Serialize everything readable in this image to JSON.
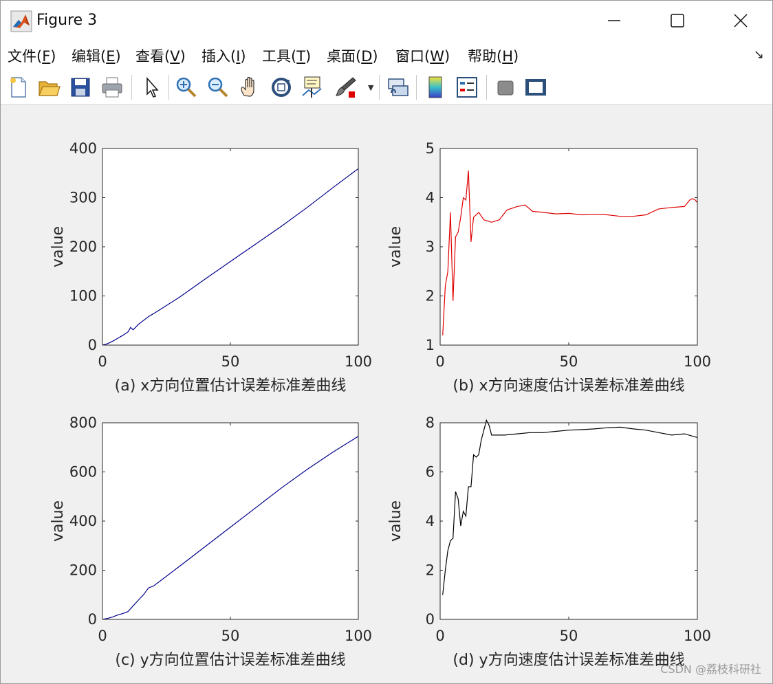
{
  "window": {
    "title": "Figure 3",
    "min_icon": "minimize-icon",
    "max_icon": "maximize-icon",
    "close_icon": "close-icon"
  },
  "menubar": {
    "items": [
      {
        "label": "文件(",
        "key": "F",
        "tail": ")"
      },
      {
        "label": "编辑(",
        "key": "E",
        "tail": ")"
      },
      {
        "label": "查看(",
        "key": "V",
        "tail": ")"
      },
      {
        "label": "插入(",
        "key": "I",
        "tail": ")"
      },
      {
        "label": "工具(",
        "key": "T",
        "tail": ")"
      },
      {
        "label": "桌面(",
        "key": "D",
        "tail": ")"
      },
      {
        "label": "窗口(",
        "key": "W",
        "tail": ")"
      },
      {
        "label": "帮助(",
        "key": "H",
        "tail": ")"
      }
    ],
    "corner_glyph": "↘"
  },
  "toolbar": {
    "icons": [
      "new-figure-icon",
      "open-file-icon",
      "save-icon",
      "print-icon",
      "edit-plot-arrow-icon",
      "zoom-in-icon",
      "zoom-out-icon",
      "pan-hand-icon",
      "rotate-3d-icon",
      "data-cursor-icon",
      "brush-icon",
      "brush-dropdown-icon",
      "link-plot-icon",
      "colorbar-icon",
      "legend-icon",
      "hide-plot-tools-icon",
      "show-plot-tools-icon"
    ]
  },
  "colors": {
    "blue_series": "#00008b",
    "red_series": "#e00000",
    "black_series": "#000000"
  },
  "chart_data": [
    {
      "type": "line",
      "caption": "(a) x方向位置估计误差标准差曲线",
      "ylabel": "value",
      "xlim": [
        0,
        100
      ],
      "ylim": [
        0,
        400
      ],
      "xticks": [
        0,
        50,
        100
      ],
      "yticks": [
        0,
        100,
        200,
        300,
        400
      ],
      "color": "#00008b",
      "x": [
        0,
        2,
        4,
        6,
        8,
        10,
        11,
        12,
        14,
        16,
        18,
        20,
        30,
        40,
        50,
        60,
        70,
        80,
        90,
        100
      ],
      "y": [
        0,
        3,
        8,
        14,
        20,
        27,
        36,
        31,
        42,
        50,
        58,
        64,
        97,
        134,
        170,
        206,
        242,
        280,
        320,
        359
      ]
    },
    {
      "type": "line",
      "caption": "(b) x方向速度估计误差标准差曲线",
      "ylabel": "value",
      "xlim": [
        0,
        100
      ],
      "ylim": [
        1,
        5
      ],
      "xticks": [
        0,
        50,
        100
      ],
      "yticks": [
        1,
        2,
        3,
        4,
        5
      ],
      "color": "#e00000",
      "x": [
        1,
        2,
        3,
        4,
        5,
        6,
        7,
        8,
        9,
        10,
        11,
        12,
        13,
        15,
        17,
        20,
        23,
        26,
        30,
        33,
        36,
        40,
        45,
        50,
        55,
        60,
        65,
        70,
        75,
        80,
        85,
        90,
        95,
        97,
        98,
        99,
        100
      ],
      "y": [
        1.2,
        2.2,
        2.5,
        3.7,
        1.9,
        3.2,
        3.3,
        3.6,
        4.0,
        3.95,
        4.55,
        3.1,
        3.6,
        3.7,
        3.55,
        3.5,
        3.55,
        3.75,
        3.82,
        3.85,
        3.72,
        3.7,
        3.67,
        3.68,
        3.65,
        3.66,
        3.65,
        3.62,
        3.62,
        3.65,
        3.77,
        3.8,
        3.82,
        3.95,
        3.98,
        3.96,
        3.9
      ]
    },
    {
      "type": "line",
      "caption": "(c) y方向位置估计误差标准差曲线",
      "ylabel": "value",
      "xlim": [
        0,
        100
      ],
      "ylim": [
        0,
        800
      ],
      "xticks": [
        0,
        50,
        100
      ],
      "yticks": [
        0,
        200,
        400,
        600,
        800
      ],
      "color": "#00008b",
      "x": [
        0,
        2,
        4,
        6,
        8,
        10,
        12,
        14,
        16,
        18,
        20,
        30,
        40,
        50,
        60,
        70,
        80,
        90,
        100
      ],
      "y": [
        0,
        4,
        10,
        18,
        24,
        32,
        55,
        78,
        100,
        128,
        136,
        215,
        295,
        375,
        455,
        535,
        610,
        680,
        745
      ]
    },
    {
      "type": "line",
      "caption": "(d) y方向速度估计误差标准差曲线",
      "ylabel": "value",
      "xlim": [
        0,
        100
      ],
      "ylim": [
        0,
        8
      ],
      "xticks": [
        0,
        50,
        100
      ],
      "yticks": [
        0,
        2,
        4,
        6,
        8
      ],
      "color": "#000000",
      "x": [
        1,
        2,
        3,
        4,
        5,
        6,
        7,
        8,
        9,
        10,
        11,
        12,
        13,
        14,
        15,
        16,
        17,
        18,
        19,
        20,
        25,
        30,
        35,
        40,
        45,
        50,
        55,
        60,
        65,
        70,
        75,
        80,
        85,
        90,
        95,
        100
      ],
      "y": [
        1.0,
        2.0,
        2.8,
        3.2,
        3.3,
        5.2,
        4.9,
        3.8,
        4.4,
        4.2,
        5.4,
        5.4,
        6.7,
        6.6,
        6.7,
        7.3,
        7.7,
        8.1,
        7.9,
        7.5,
        7.5,
        7.55,
        7.6,
        7.6,
        7.65,
        7.7,
        7.72,
        7.75,
        7.8,
        7.82,
        7.75,
        7.7,
        7.6,
        7.5,
        7.55,
        7.4
      ]
    }
  ],
  "watermark": "CSDN @荔枝科研社"
}
